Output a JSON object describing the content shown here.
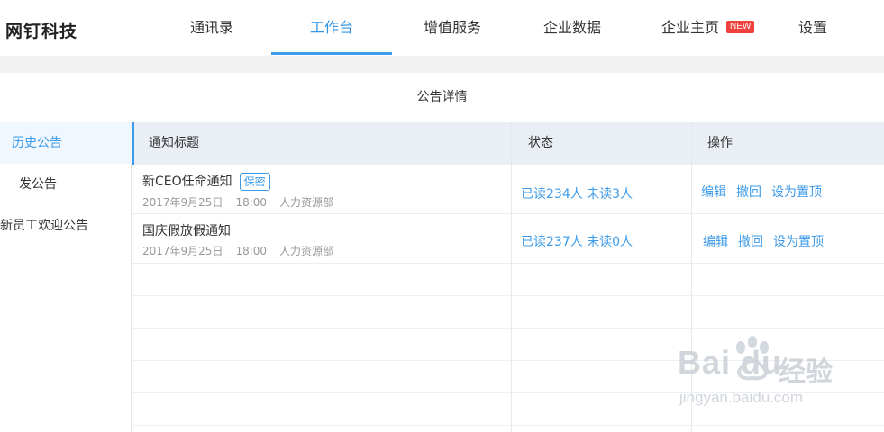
{
  "app": {
    "logo": "网钉科技"
  },
  "nav": {
    "items": [
      {
        "label": "通讯录"
      },
      {
        "label": "工作台",
        "active": true
      },
      {
        "label": "增值服务"
      },
      {
        "label": "企业数据"
      },
      {
        "label": "企业主页",
        "badge": "NEW"
      },
      {
        "label": "设置"
      }
    ]
  },
  "page": {
    "title": "公告详情"
  },
  "sidebar": {
    "items": [
      {
        "label": "历史公告",
        "active": true
      },
      {
        "label": "发公告"
      },
      {
        "label": "新员工欢迎公告"
      }
    ]
  },
  "table": {
    "headers": [
      "通知标题",
      "状态",
      "操作"
    ],
    "rows": [
      {
        "title": "新CEO任命通知",
        "badge": "保密",
        "date": "2017年9月25日",
        "time": "18:00",
        "dept": "人力资源部",
        "status": "已读234人 未读3人",
        "ops": [
          "编辑",
          "撤回",
          "设为置顶"
        ]
      },
      {
        "title": "国庆假放假通知",
        "date": "2017年9月25日",
        "time": "18:00",
        "dept": "人力资源部",
        "status": "已读237人 未读0人",
        "ops": [
          "编辑",
          "撤回",
          "设为置顶"
        ]
      }
    ]
  },
  "watermark": {
    "logo": "Bai du",
    "cn": "经验",
    "url": "jingyan.baidu.com"
  },
  "colors": {
    "accent": "#3d9be9",
    "badge_red": "#f0423d",
    "header_bg": "#eaeff6"
  }
}
